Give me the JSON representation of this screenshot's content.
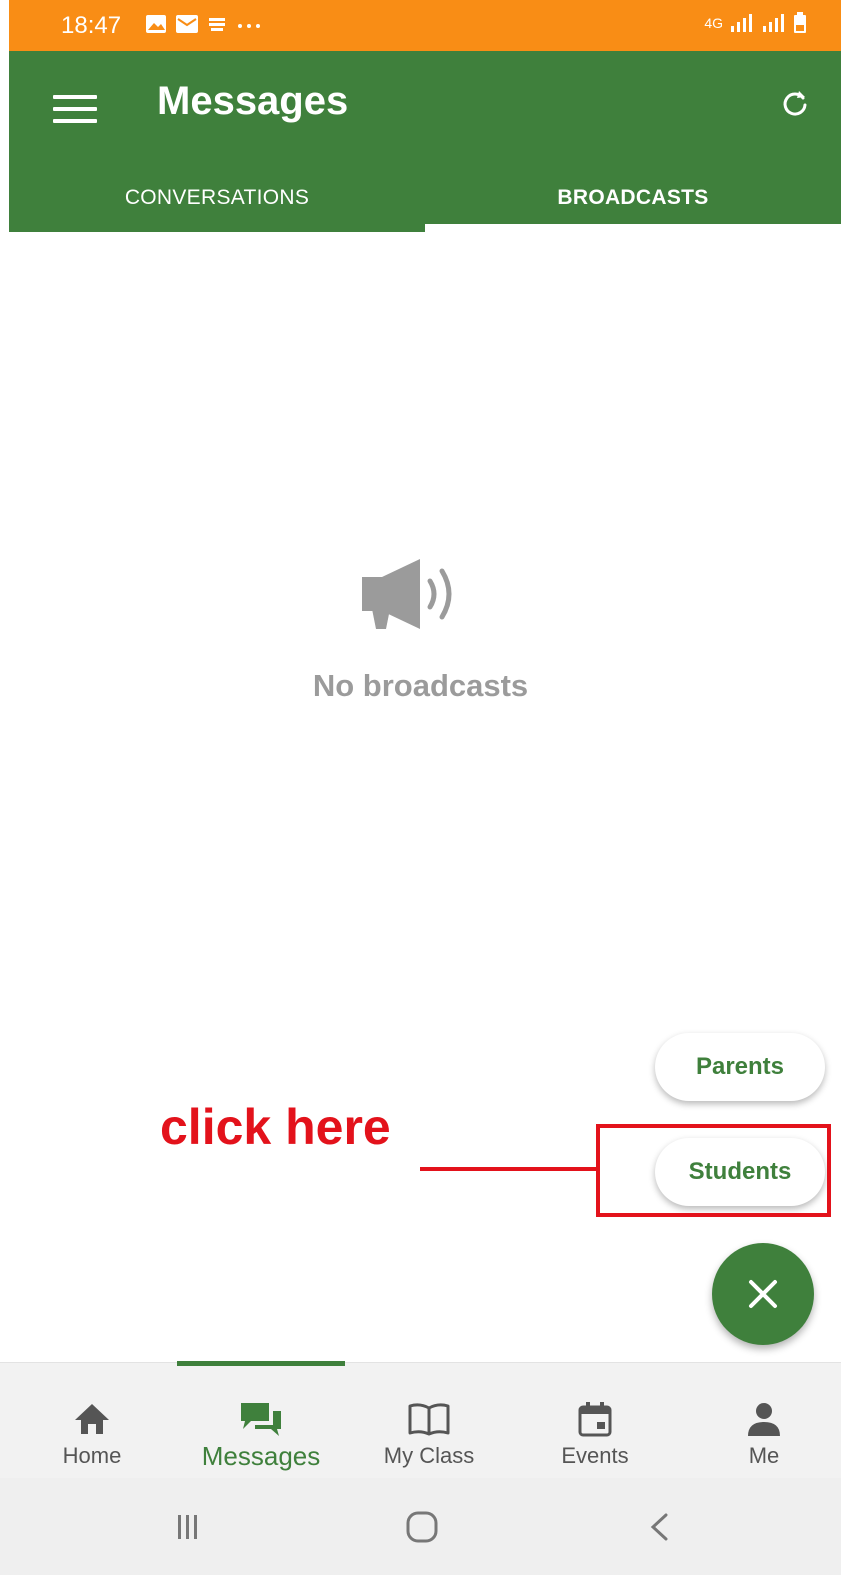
{
  "status": {
    "time": "18:47",
    "network": "4G"
  },
  "appbar": {
    "title": "Messages"
  },
  "tabs": [
    {
      "label": "CONVERSATIONS",
      "active": false
    },
    {
      "label": "BROADCASTS",
      "active": true
    }
  ],
  "empty_state": {
    "text": "No broadcasts",
    "icon": "megaphone-icon"
  },
  "speed_dial": {
    "parents_label": "Parents",
    "students_label": "Students",
    "fab_icon": "close-icon"
  },
  "annotation": {
    "text": "click here",
    "color": "#e3121b"
  },
  "bottom_nav": [
    {
      "label": "Home",
      "icon": "home-icon"
    },
    {
      "label": "Messages",
      "icon": "chat-icon",
      "active": true
    },
    {
      "label": "My Class",
      "icon": "book-icon"
    },
    {
      "label": "Events",
      "icon": "calendar-icon"
    },
    {
      "label": "Me",
      "icon": "person-icon"
    }
  ],
  "colors": {
    "status_bar": "#f98d15",
    "primary": "#3f803c",
    "muted_text": "#9b9b9b"
  }
}
